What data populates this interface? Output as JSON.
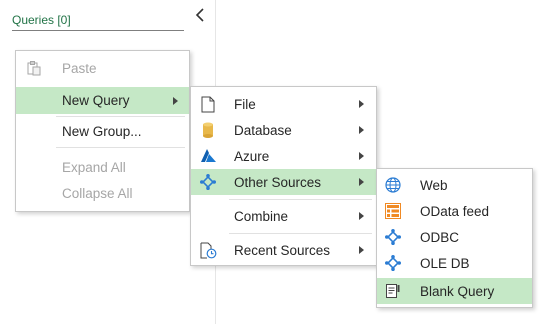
{
  "queries_pane": {
    "header": "Queries [0]",
    "collapse_icon": "chevron-left-icon"
  },
  "context_menu": {
    "items": [
      {
        "label": "Paste",
        "icon": "paste-icon",
        "disabled": true
      },
      {
        "label": "New Query",
        "highlighted": true,
        "submenu": true
      },
      {
        "label": "New Group..."
      },
      {
        "label": "Expand All",
        "disabled": true
      },
      {
        "label": "Collapse All",
        "disabled": true
      }
    ]
  },
  "new_query_menu": {
    "items": [
      {
        "label": "File",
        "icon": "file-icon",
        "submenu": true
      },
      {
        "label": "Database",
        "icon": "database-icon",
        "submenu": true
      },
      {
        "label": "Azure",
        "icon": "azure-icon",
        "submenu": true
      },
      {
        "label": "Other Sources",
        "icon": "other-sources-icon",
        "submenu": true,
        "highlighted": true
      },
      {
        "label": "Combine",
        "submenu": true
      },
      {
        "label": "Recent Sources",
        "icon": "recent-sources-icon",
        "submenu": true
      }
    ]
  },
  "other_sources_menu": {
    "items": [
      {
        "label": "Web",
        "icon": "globe-icon"
      },
      {
        "label": "OData feed",
        "icon": "odata-feed-icon"
      },
      {
        "label": "ODBC",
        "icon": "odbc-icon"
      },
      {
        "label": "OLE DB",
        "icon": "ole-db-icon"
      },
      {
        "label": "Blank Query",
        "icon": "blank-query-icon",
        "highlighted": true
      }
    ]
  },
  "colors": {
    "highlight": "#c5e8c6",
    "accent_green": "#217346",
    "connector_blue": "#2b7cd3",
    "database_gold": "#e8b84a",
    "odata_orange": "#f08a24"
  }
}
